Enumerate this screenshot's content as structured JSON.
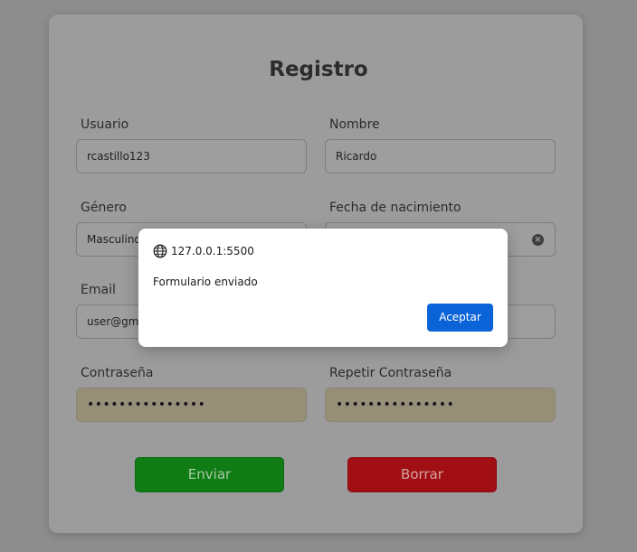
{
  "form": {
    "title": "Registro",
    "fields": {
      "usuario": {
        "label": "Usuario",
        "value": "rcastillo123"
      },
      "nombre": {
        "label": "Nombre",
        "value": "Ricardo"
      },
      "genero": {
        "label": "Género",
        "value": "Masculino"
      },
      "fecha": {
        "label": "Fecha de nacimiento",
        "value": ""
      },
      "email": {
        "label": "Email",
        "value": "user@gma"
      },
      "contrasena": {
        "label": "Contraseña",
        "value": "•••••••••••••••"
      },
      "repetir": {
        "label": "Repetir Contraseña",
        "value": "•••••••••••••••"
      }
    },
    "buttons": {
      "send": "Enviar",
      "clear": "Borrar"
    }
  },
  "dialog": {
    "origin": "127.0.0.1:5500",
    "message": "Formulario enviado",
    "ok_label": "Aceptar"
  },
  "colors": {
    "send_button": "#0f7d14",
    "clear_button": "#a10f14",
    "dialog_ok": "#0b63d8"
  }
}
